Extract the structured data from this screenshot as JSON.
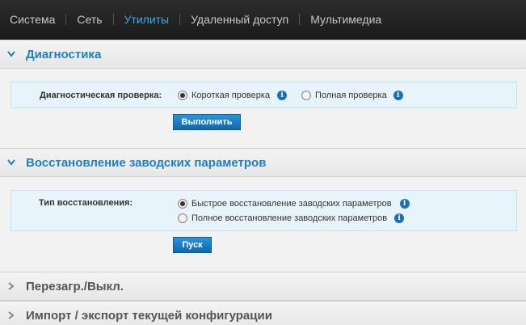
{
  "nav": {
    "items": [
      "Система",
      "Сеть",
      "Утилиты",
      "Удаленный доступ",
      "Мультимедиа"
    ],
    "active_index": 2
  },
  "sections": {
    "diagnostics": {
      "title": "Диагностика",
      "test_label": "Диагностическая проверка:",
      "options": [
        "Короткая проверка",
        "Полная проверка"
      ],
      "selected": 0,
      "run_button": "Выполнить"
    },
    "factory_restore": {
      "title": "Восстановление заводских параметров",
      "type_label": "Тип восстановления:",
      "options": [
        "Быстрое восстановление заводских параметров",
        "Полное восстановление заводских параметров"
      ],
      "selected": 0,
      "start_button": "Пуск"
    },
    "reboot": {
      "title": "Перезагр./Выкл."
    },
    "import_export": {
      "title": "Импорт / экспорт текущей конфигурации"
    }
  },
  "colors": {
    "accent": "#1f7fc3",
    "nav_active": "#3fa9e8",
    "panel_bg": "#e8f4fb",
    "button": "#1a78c2"
  }
}
